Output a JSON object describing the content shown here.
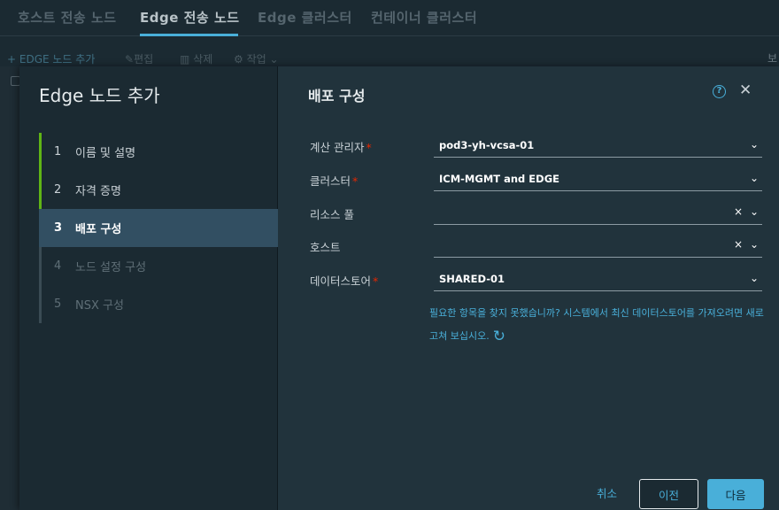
{
  "topnav": {
    "tabs": [
      {
        "label": "호스트 전송 노드",
        "active": false
      },
      {
        "label": "Edge 전송 노드",
        "active": true
      },
      {
        "label": "Edge 클러스터",
        "active": false
      },
      {
        "label": "컨테이너 클러스터",
        "active": false
      }
    ]
  },
  "toolbar": {
    "add_label": "EDGE 노드 추가",
    "edit_label": "편집",
    "delete_label": "삭제",
    "actions_label": "작업",
    "right_label": "보"
  },
  "modal": {
    "title": "Edge 노드 추가",
    "section_title": "배포 구성",
    "steps": [
      {
        "num": "1",
        "label": "이름 및 설명",
        "state": "done"
      },
      {
        "num": "2",
        "label": "자격 증명",
        "state": "done"
      },
      {
        "num": "3",
        "label": "배포 구성",
        "state": "active"
      },
      {
        "num": "4",
        "label": "노드 설정 구성",
        "state": "disabled"
      },
      {
        "num": "5",
        "label": "NSX 구성",
        "state": "disabled"
      }
    ],
    "fields": {
      "compute_manager": {
        "label": "계산 관리자",
        "required": "*",
        "value": "pod3-yh-vcsa-01"
      },
      "cluster": {
        "label": "클러스터",
        "required": "*",
        "value": "ICM-MGMT and EDGE"
      },
      "resource_pool": {
        "label": "리소스 풀",
        "value": ""
      },
      "host": {
        "label": "호스트",
        "value": ""
      },
      "datastore": {
        "label": "데이터스토어",
        "required": "*",
        "value": "SHARED-01"
      }
    },
    "hint": "필요한 항목을 찾지 못했습니까? 시스템에서 최신 데이터스토어를 가져오려면 새로 고쳐 보십시오.",
    "buttons": {
      "cancel": "취소",
      "previous": "이전",
      "next": "다음"
    }
  },
  "colors": {
    "accent": "#49afd9",
    "complete": "#60b515",
    "required": "#e62700",
    "active_step_bg": "#324f62"
  }
}
